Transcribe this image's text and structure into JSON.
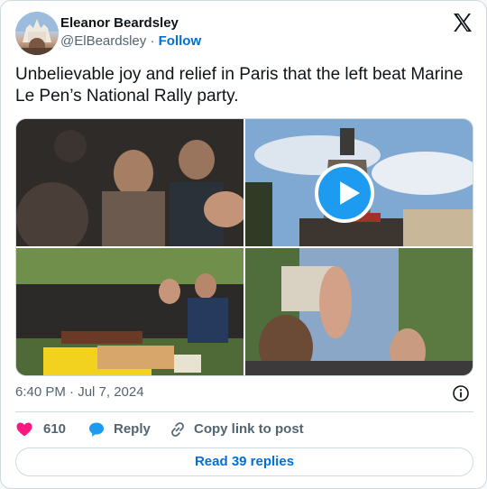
{
  "author": {
    "name": "Eleanor Beardsley",
    "handle": "@ElBeardsley",
    "separator": " · ",
    "follow_label": "Follow"
  },
  "tweet": {
    "text": "Unbelievable joy and relief in Paris that the left beat Marine Le Pen’s National Rally party."
  },
  "media": {
    "count": 4,
    "has_video": true
  },
  "meta": {
    "timestamp": "6:40 PM · Jul 7, 2024"
  },
  "actions": {
    "like_count": "610",
    "reply_label": "Reply",
    "copy_label": "Copy link to post"
  },
  "footer": {
    "read_replies_label": "Read 39 replies"
  },
  "colors": {
    "accent": "#006fd6",
    "like": "#f91880",
    "reply": "#1d9bf0",
    "muted": "#536471"
  }
}
